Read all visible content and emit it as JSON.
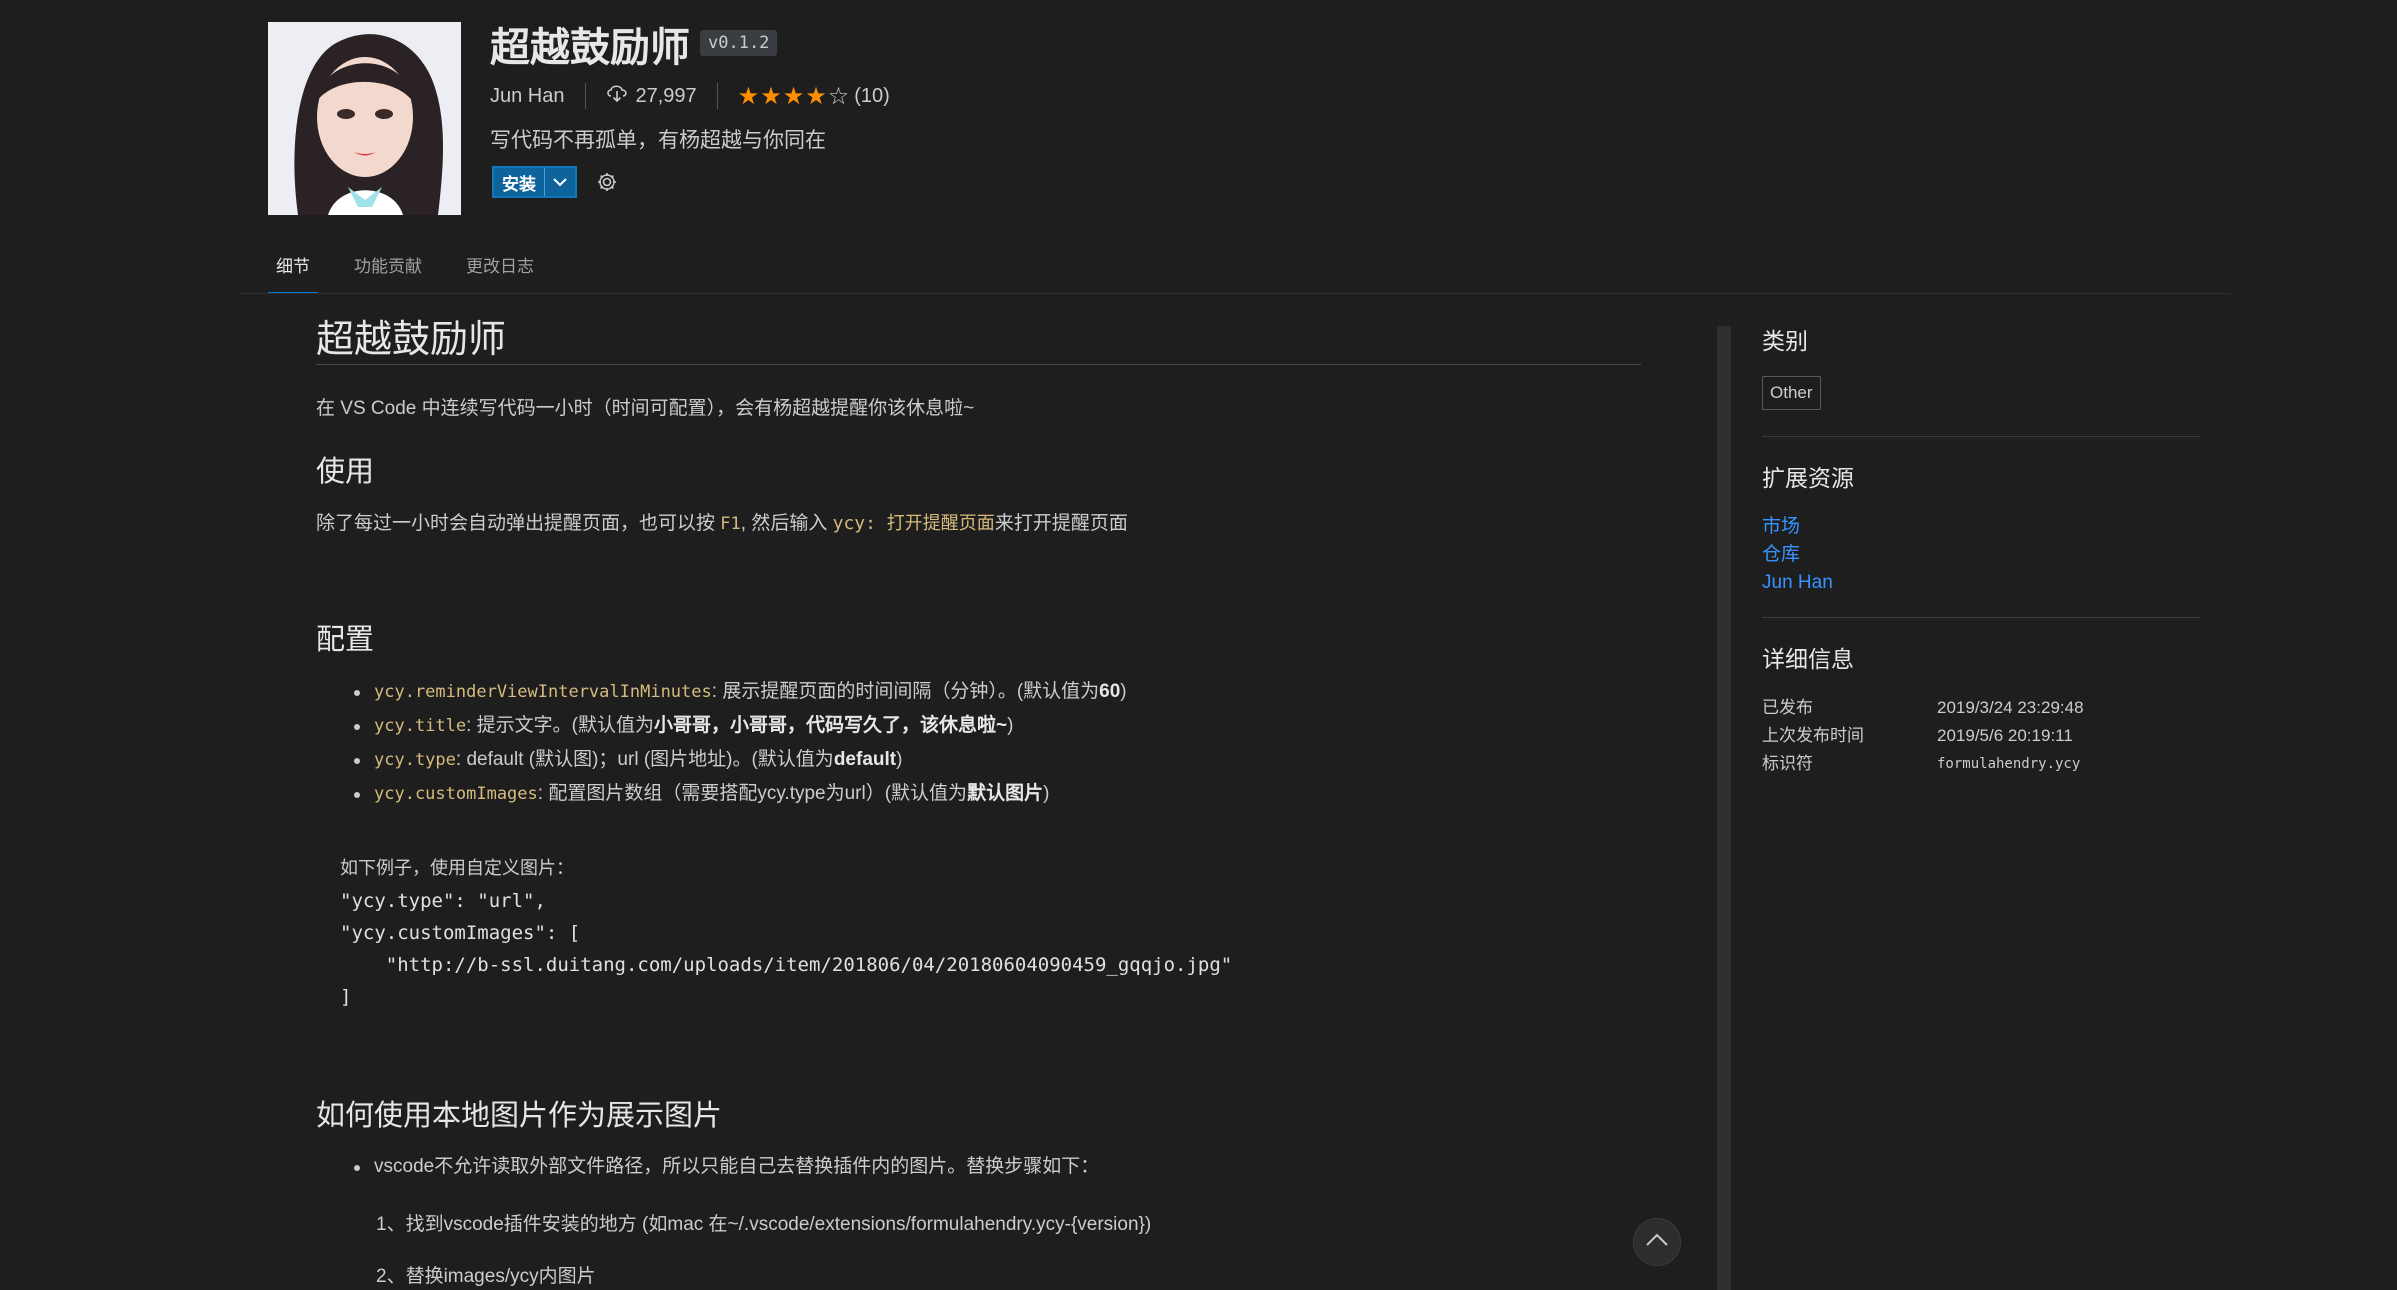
{
  "extension": {
    "name": "超越鼓励师",
    "version": "v0.1.2",
    "publisher": "Jun Han",
    "installs": "27,997",
    "rating_count": "(10)",
    "rating_stars": 4,
    "description": "写代码不再孤单，有杨超越与你同在",
    "install_label": "安装"
  },
  "tabs": [
    {
      "label": "细节"
    },
    {
      "label": "功能贡献"
    },
    {
      "label": "更改日志"
    }
  ],
  "readme": {
    "title": "超越鼓励师",
    "intro": "在 VS Code 中连续写代码一小时（时间可配置），会有杨超越提醒你该休息啦~",
    "usage_heading": "使用",
    "usage_p1": "除了每过一小时会自动弹出提醒页面，也可以按 ",
    "usage_key": "F1",
    "usage_p2": ", 然后输入 ",
    "usage_cmd_prefix": "ycy:",
    "usage_cmd": " 打开提醒页面",
    "usage_p3": "来打开提醒页面",
    "config_heading": "配置",
    "config_items": [
      {
        "key": "ycy.reminderViewIntervalInMinutes",
        "text": ": 展示提醒页面的时间间隔（分钟）。(默认值为",
        "bold": "60",
        "end": ")"
      },
      {
        "key": "ycy.title",
        "text": ": 提示文字。(默认值为",
        "bold": "小哥哥，小哥哥，代码写久了，该休息啦~",
        "end": ")"
      },
      {
        "key": "ycy.type",
        "text": ": default (默认图)；url (图片地址)。(默认值为",
        "bold": "default",
        "end": ")"
      },
      {
        "key": "ycy.customImages",
        "text": ": 配置图片数组（需要搭配ycy.type为url）(默认值为",
        "bold": "默认图片",
        "end": ")"
      }
    ],
    "code_comment": "如下例子，使用自定义图片：",
    "code_line1": "\"ycy.type\": \"url\",",
    "code_line2": "\"ycy.customImages\": [",
    "code_line3": "    \"http://b-ssl.duitang.com/uploads/item/201806/04/20180604090459_gqqjo.jpg\"",
    "code_line4": "]",
    "local_heading": "如何使用本地图片作为展示图片",
    "local_bullet": "vscode不允许读取外部文件路径，所以只能自己去替换插件内的图片。替换步骤如下：",
    "local_step1": "1、找到vscode插件安装的地方 (如mac 在~/.vscode/extensions/formulahendry.ycy-{version})",
    "local_step2": "2、替换images/ycy内图片"
  },
  "sidebar": {
    "categories_title": "类别",
    "category": "Other",
    "resources_title": "扩展资源",
    "resources": [
      {
        "label": "市场"
      },
      {
        "label": "仓库"
      },
      {
        "label": "Jun Han"
      }
    ],
    "details_title": "详细信息",
    "details": [
      {
        "key": "已发布",
        "value": "2019/3/24 23:29:48"
      },
      {
        "key": "上次发布时间",
        "value": "2019/5/6 20:19:11"
      },
      {
        "key": "标识符",
        "value": "formulahendry.ycy"
      }
    ]
  },
  "icons": {
    "download": "cloud-download-icon",
    "gear": "gear-icon",
    "chevron": "chevron-down-icon",
    "scroll_top": "chevron-up-icon"
  },
  "colors": {
    "background": "#1e1e1e",
    "accent_blue": "#0e639c",
    "link": "#3794ff",
    "star": "#ff8e00",
    "code": "#d7ba7d"
  }
}
